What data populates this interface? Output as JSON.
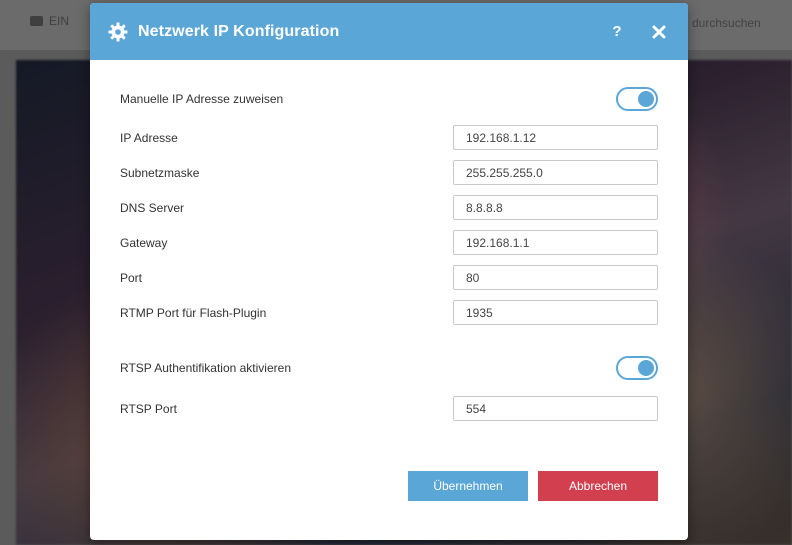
{
  "background": {
    "left_label": "EIN",
    "right_label": "durchsuchen"
  },
  "dialog": {
    "title": "Netzwerk IP Konfiguration",
    "help_label": "?",
    "manual_ip": {
      "label": "Manuelle IP Adresse zuweisen",
      "enabled": true
    },
    "fields": [
      {
        "label": "IP Adresse",
        "value": "192.168.1.12"
      },
      {
        "label": "Subnetzmaske",
        "value": "255.255.255.0"
      },
      {
        "label": "DNS Server",
        "value": "8.8.8.8"
      },
      {
        "label": "Gateway",
        "value": "192.168.1.1"
      },
      {
        "label": "Port",
        "value": "80"
      },
      {
        "label": "RTMP Port für Flash-Plugin",
        "value": "1935"
      }
    ],
    "rtsp_auth": {
      "label": "RTSP Authentifikation aktivieren",
      "enabled": true
    },
    "rtsp_port": {
      "label": "RTSP Port",
      "value": "554"
    },
    "apply_label": "Übernehmen",
    "cancel_label": "Abbrechen"
  },
  "colors": {
    "accent": "#5aa6d6",
    "cancel": "#d23f4f"
  },
  "icons": {
    "header": "gear-icon",
    "close": "close-icon",
    "background_left": "camera-icon"
  }
}
